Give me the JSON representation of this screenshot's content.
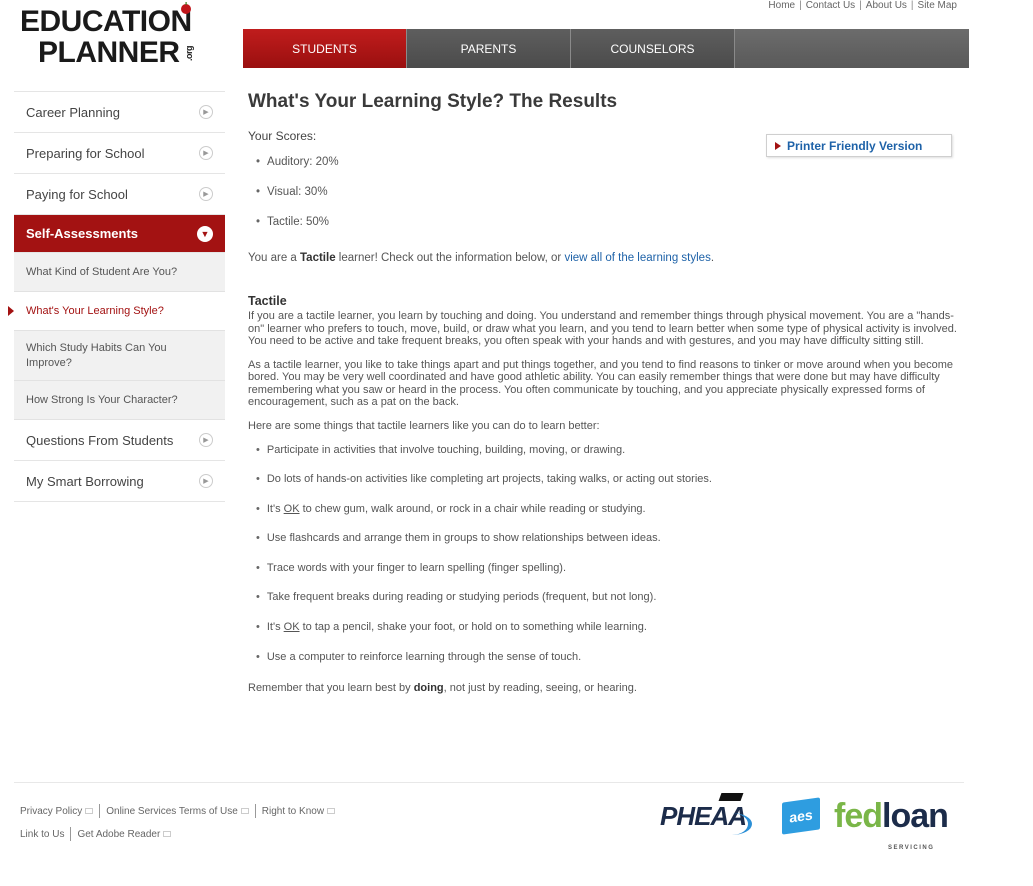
{
  "logo": {
    "line1": "EDUCATION",
    "line2": "PLANNER",
    "suffix": ".org"
  },
  "toplinks": [
    "Home",
    "Contact Us",
    "About Us",
    "Site Map"
  ],
  "nav": {
    "tabs": [
      {
        "label": "STUDENTS",
        "active": true
      },
      {
        "label": "PARENTS",
        "active": false
      },
      {
        "label": "COUNSELORS",
        "active": false
      }
    ]
  },
  "sidebar": {
    "items": [
      {
        "label": "Career Planning"
      },
      {
        "label": "Preparing for School"
      },
      {
        "label": "Paying for School"
      },
      {
        "label": "Self-Assessments"
      },
      {
        "label": "Questions From Students"
      },
      {
        "label": "My Smart Borrowing"
      }
    ],
    "subitems": [
      {
        "label": "What Kind of Student Are You?"
      },
      {
        "label": "What's Your Learning Style?"
      },
      {
        "label": "Which Study Habits Can You Improve?"
      },
      {
        "label": "How Strong Is Your Character?"
      }
    ]
  },
  "main": {
    "title": "What's Your Learning Style? The Results",
    "scores_label": "Your Scores:",
    "printer_label": "Printer Friendly Version",
    "scores": [
      "Auditory: 20%",
      "Visual: 30%",
      "Tactile: 50%"
    ],
    "intro_pre": "You are a ",
    "intro_bold": "Tactile",
    "intro_mid": " learner! Check out the information below, or ",
    "intro_link": "view all of the learning styles",
    "intro_end": ".",
    "section_title": "Tactile",
    "para1": "If you are a tactile learner, you learn by touching and doing. You understand and remember things through physical movement. You are a \"hands-on\" learner who prefers to touch, move, build, or draw what you learn, and you tend to learn better when some type of physical activity is involved. You need to be active and take frequent breaks, you often speak with your hands and with gestures, and you may have difficulty sitting still.",
    "para2": "As a tactile learner, you like to take things apart and put things together, and you tend to find reasons to tinker or move around when you become bored. You may be very well coordinated and have good athletic ability. You can easily remember things that were done but may have difficulty remembering what you saw or heard in the process. You often communicate by touching, and you appreciate physically expressed forms of encouragement, such as a pat on the back.",
    "para3": "Here are some things that tactile learners like you can do to learn better:",
    "tips": [
      "Participate in activities that involve touching, building, moving, or drawing.",
      "Do lots of hands-on activities like completing art projects, taking walks, or acting out stories.",
      "It's OK to chew gum, walk around, or rock in a chair while reading or studying.",
      "Use flashcards and arrange them in groups to show relationships between ideas.",
      "Trace words with your finger to learn spelling (finger spelling).",
      "Take frequent breaks during reading or studying periods (frequent, but not long).",
      "It's OK to tap a pencil, shake your foot, or hold on to something while learning.",
      "Use a computer to reinforce learning through the sense of touch."
    ],
    "remember_pre": "Remember that you learn best by ",
    "remember_bold": "doing",
    "remember_post": ", not just by reading, seeing, or hearing."
  },
  "footer": {
    "row1": [
      "Privacy Policy",
      "Online Services Terms of Use",
      "Right to Know"
    ],
    "row2": [
      "Link to Us",
      "Get Adobe Reader"
    ],
    "partners": {
      "pheaa": "PHEAA",
      "aes": "aes",
      "fed": "fed",
      "loan": "loan",
      "servicing": "SERVICING"
    }
  }
}
